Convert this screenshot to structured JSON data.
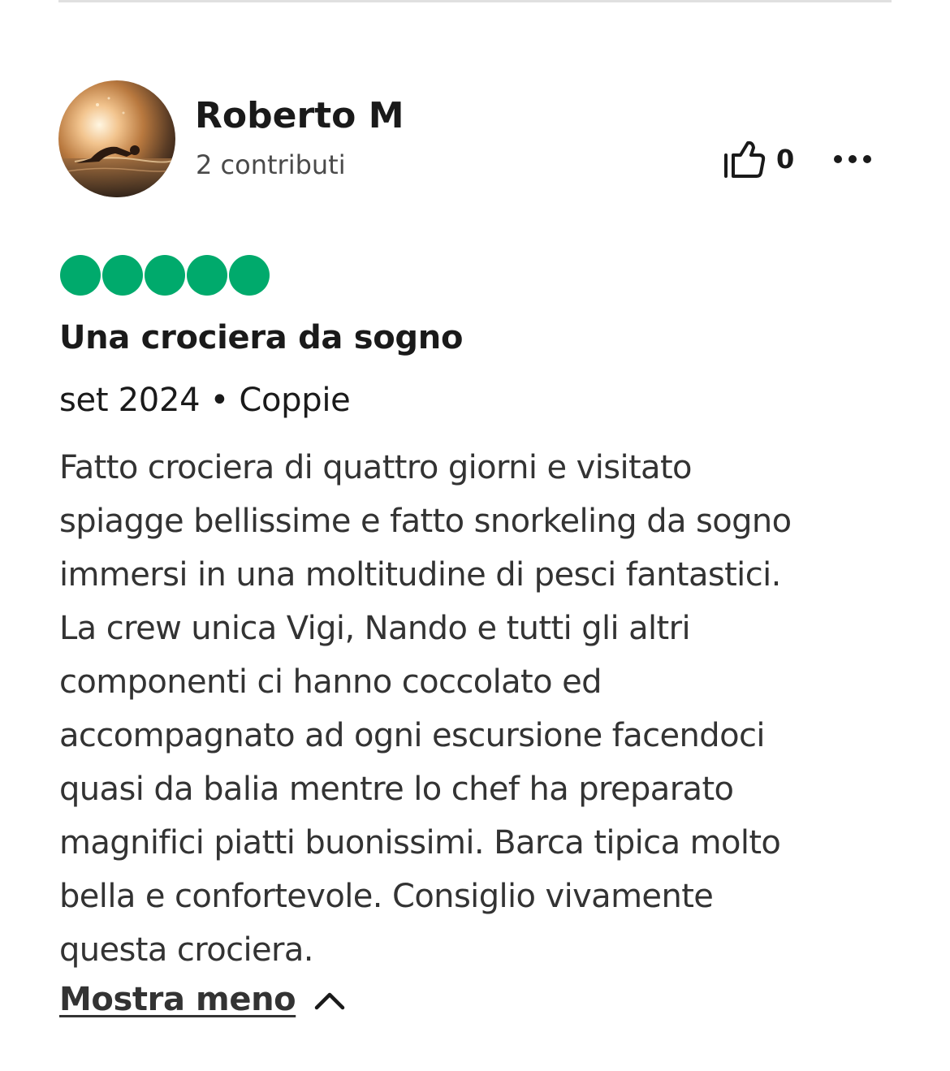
{
  "review": {
    "author": {
      "name": "Roberto M",
      "contributions": "2 contributi"
    },
    "helpful_count": "0",
    "rating": {
      "value": 5,
      "max": 5,
      "color": "#00aa6c"
    },
    "title": "Una crociera da sogno",
    "meta": "set 2024 • Coppie",
    "body_lines": [
      "Fatto crociera di quattro giorni e visitato",
      "spiagge bellissime e fatto snorkeling da sogno",
      "immersi in una moltitudine di pesci fantastici.",
      "La crew unica Vigi, Nando e tutti gli altri",
      "componenti ci hanno coccolato ed",
      "accompagnato ad ogni escursione facendoci",
      "quasi da balia mentre lo chef ha preparato",
      "magnifici piatti buonissimi. Barca tipica molto",
      "bella e confortevole. Consiglio vivamente",
      "questa crociera."
    ],
    "show_less_label": "Mostra meno"
  },
  "icons": {
    "helpful": "thumbs-up-icon",
    "more": "more-options-icon",
    "toggle": "chevron-up-icon"
  }
}
